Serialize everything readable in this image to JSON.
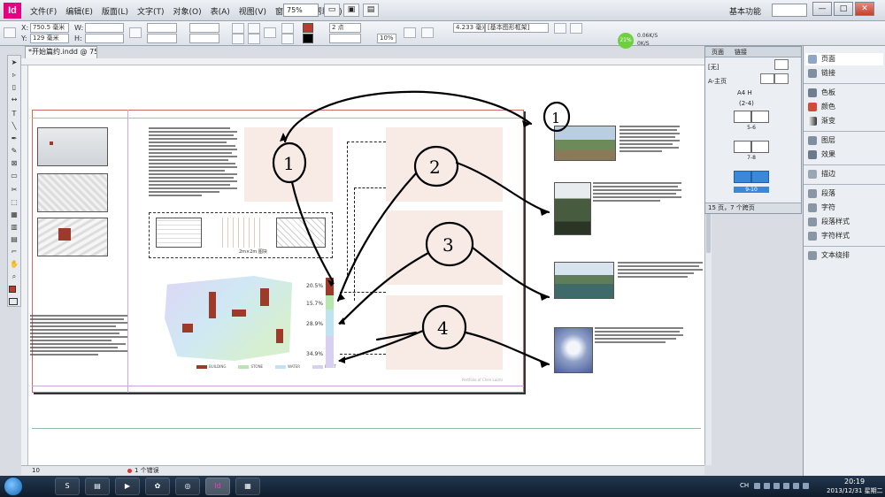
{
  "app": {
    "logo": "Id",
    "menu": [
      "文件(F)",
      "编辑(E)",
      "版面(L)",
      "文字(T)",
      "对象(O)",
      "表(A)",
      "视图(V)",
      "窗口(W)",
      "帮助(H)"
    ],
    "zoom": "75%",
    "workspace": "基本功能",
    "window_buttons": {
      "minimize": "—",
      "maximize": "□",
      "close": "✕"
    }
  },
  "control_bar": {
    "x_label": "X:",
    "x_value": "750.5 毫米",
    "y_label": "Y:",
    "y_value": "129 毫米",
    "w_label": "W:",
    "h_label": "H:",
    "stroke_weight": "2 点",
    "percent": "10%",
    "dimension": "4.233 毫米",
    "style": "[基本图形框架]",
    "fill_color": "#c0392b",
    "perf": {
      "percent": "21%",
      "up": "0.06K/S",
      "down": "0K/S"
    }
  },
  "document": {
    "tab_title": "*开始篇约.indd @ 75%",
    "map_caption": "2m×2m 图块",
    "map_legend": [
      "BUILDING",
      "STONE",
      "WATER",
      "PLANT"
    ],
    "map_legend_colors": [
      "#9c3b2a",
      "#b8e6b0",
      "#bfe3ef",
      "#d7d0f0"
    ],
    "percentages": [
      "20.5%",
      "15.7%",
      "28.9%",
      "34.9%"
    ],
    "footer": "Portfolio of Chen Laizhi"
  },
  "annotations": {
    "numbers": [
      "1",
      "2",
      "3",
      "4",
      "1"
    ]
  },
  "status": {
    "page": "10",
    "errors": "1 个错误"
  },
  "pages_panel": {
    "tabs": [
      "页面",
      "链接"
    ],
    "none_master": "[无]",
    "a_master": "A-主页",
    "size": "A4 H",
    "range": "(2-4)",
    "spreads": [
      "5-6",
      "7-8",
      "9-10"
    ],
    "footer": "15 页，7 个跨页"
  },
  "right_panel": {
    "items": [
      "页面",
      "链接",
      "色板",
      "颜色",
      "渐变",
      "图层",
      "效果",
      "描边",
      "段落",
      "字符",
      "段落样式",
      "字符样式",
      "文本绕排"
    ]
  },
  "taskbar": {
    "tray": "CH",
    "time": "20:19",
    "date": "2013/12/31 星期二"
  }
}
